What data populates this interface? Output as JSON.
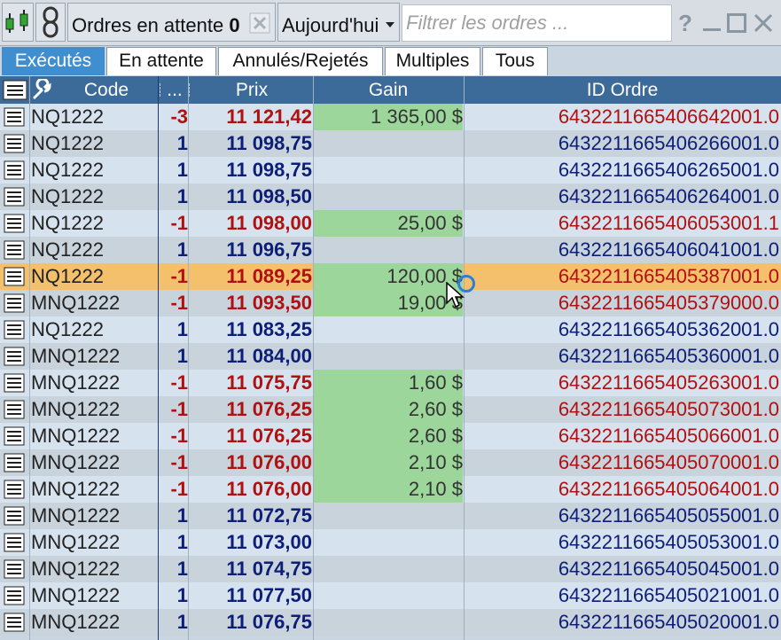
{
  "toolbar": {
    "title": "Ordres en attente",
    "count": "0",
    "period": "Aujourd'hui",
    "filter_placeholder": "Filtrer les ordres ...",
    "help": "?",
    "icons": [
      "chart-icon",
      "link-icon",
      "clear-icon",
      "dropdown-icon",
      "minimize-icon",
      "maximize-icon",
      "close-icon"
    ]
  },
  "tabs": [
    {
      "label": "Exécutés",
      "active": true
    },
    {
      "label": "En attente",
      "active": false
    },
    {
      "label": "Annulés/Rejetés",
      "active": false
    },
    {
      "label": "Multiples",
      "active": false
    },
    {
      "label": "Tous",
      "active": false
    }
  ],
  "columns": {
    "code": "Code",
    "side": "...",
    "price": "Prix",
    "gain": "Gain",
    "id": "ID Ordre"
  },
  "colors": {
    "sell": "#b01010",
    "buy": "#0d1e78",
    "gain_bg": "#9cd69a",
    "selected_row": "#f5c06b",
    "active_tab": "#3f8fd0"
  },
  "rows": [
    {
      "code": "NQ1222",
      "side": "-3",
      "price": "11 121,42",
      "gain": "1 365,00 $",
      "id": "643221166540664200​1.0"
    },
    {
      "code": "NQ1222",
      "side": "1",
      "price": "11 098,75",
      "gain": "",
      "id": "6432211665406266001.0"
    },
    {
      "code": "NQ1222",
      "side": "1",
      "price": "11 098,75",
      "gain": "",
      "id": "6432211665406265001.0"
    },
    {
      "code": "NQ1222",
      "side": "1",
      "price": "11 098,50",
      "gain": "",
      "id": "6432211665406264001.0"
    },
    {
      "code": "NQ1222",
      "side": "-1",
      "price": "11 098,00",
      "gain": "25,00 $",
      "id": "6432211665406053001.1"
    },
    {
      "code": "NQ1222",
      "side": "1",
      "price": "11 096,75",
      "gain": "",
      "id": "6432211665406041001.0"
    },
    {
      "code": "NQ1222",
      "side": "-1",
      "price": "11 089,25",
      "gain": "120,00 $",
      "id": "6432211665405387001.0",
      "selected": true
    },
    {
      "code": "MNQ1222",
      "side": "-1",
      "price": "11 093,50",
      "gain": "19,00 $",
      "id": "6432211665405379000.0"
    },
    {
      "code": "NQ1222",
      "side": "1",
      "price": "11 083,25",
      "gain": "",
      "id": "6432211665405362001.0"
    },
    {
      "code": "MNQ1222",
      "side": "1",
      "price": "11 084,00",
      "gain": "",
      "id": "6432211665405360001.0"
    },
    {
      "code": "MNQ1222",
      "side": "-1",
      "price": "11 075,75",
      "gain": "1,60 $",
      "id": "6432211665405263001.0"
    },
    {
      "code": "MNQ1222",
      "side": "-1",
      "price": "11 076,25",
      "gain": "2,60 $",
      "id": "6432211665405073001.0"
    },
    {
      "code": "MNQ1222",
      "side": "-1",
      "price": "11 076,25",
      "gain": "2,60 $",
      "id": "6432211665405066001.0"
    },
    {
      "code": "MNQ1222",
      "side": "-1",
      "price": "11 076,00",
      "gain": "2,10 $",
      "id": "6432211665405070001.0"
    },
    {
      "code": "MNQ1222",
      "side": "-1",
      "price": "11 076,00",
      "gain": "2,10 $",
      "id": "6432211665405064001.0"
    },
    {
      "code": "MNQ1222",
      "side": "1",
      "price": "11 072,75",
      "gain": "",
      "id": "6432211665405055001.0"
    },
    {
      "code": "MNQ1222",
      "side": "1",
      "price": "11 073,00",
      "gain": "",
      "id": "6432211665405053001.0"
    },
    {
      "code": "MNQ1222",
      "side": "1",
      "price": "11 074,75",
      "gain": "",
      "id": "6432211665405045001.0"
    },
    {
      "code": "MNQ1222",
      "side": "1",
      "price": "11 077,50",
      "gain": "",
      "id": "6432211665405021001.0"
    },
    {
      "code": "MNQ1222",
      "side": "1",
      "price": "11 076,75",
      "gain": "",
      "id": "6432211665405020001.0"
    }
  ]
}
